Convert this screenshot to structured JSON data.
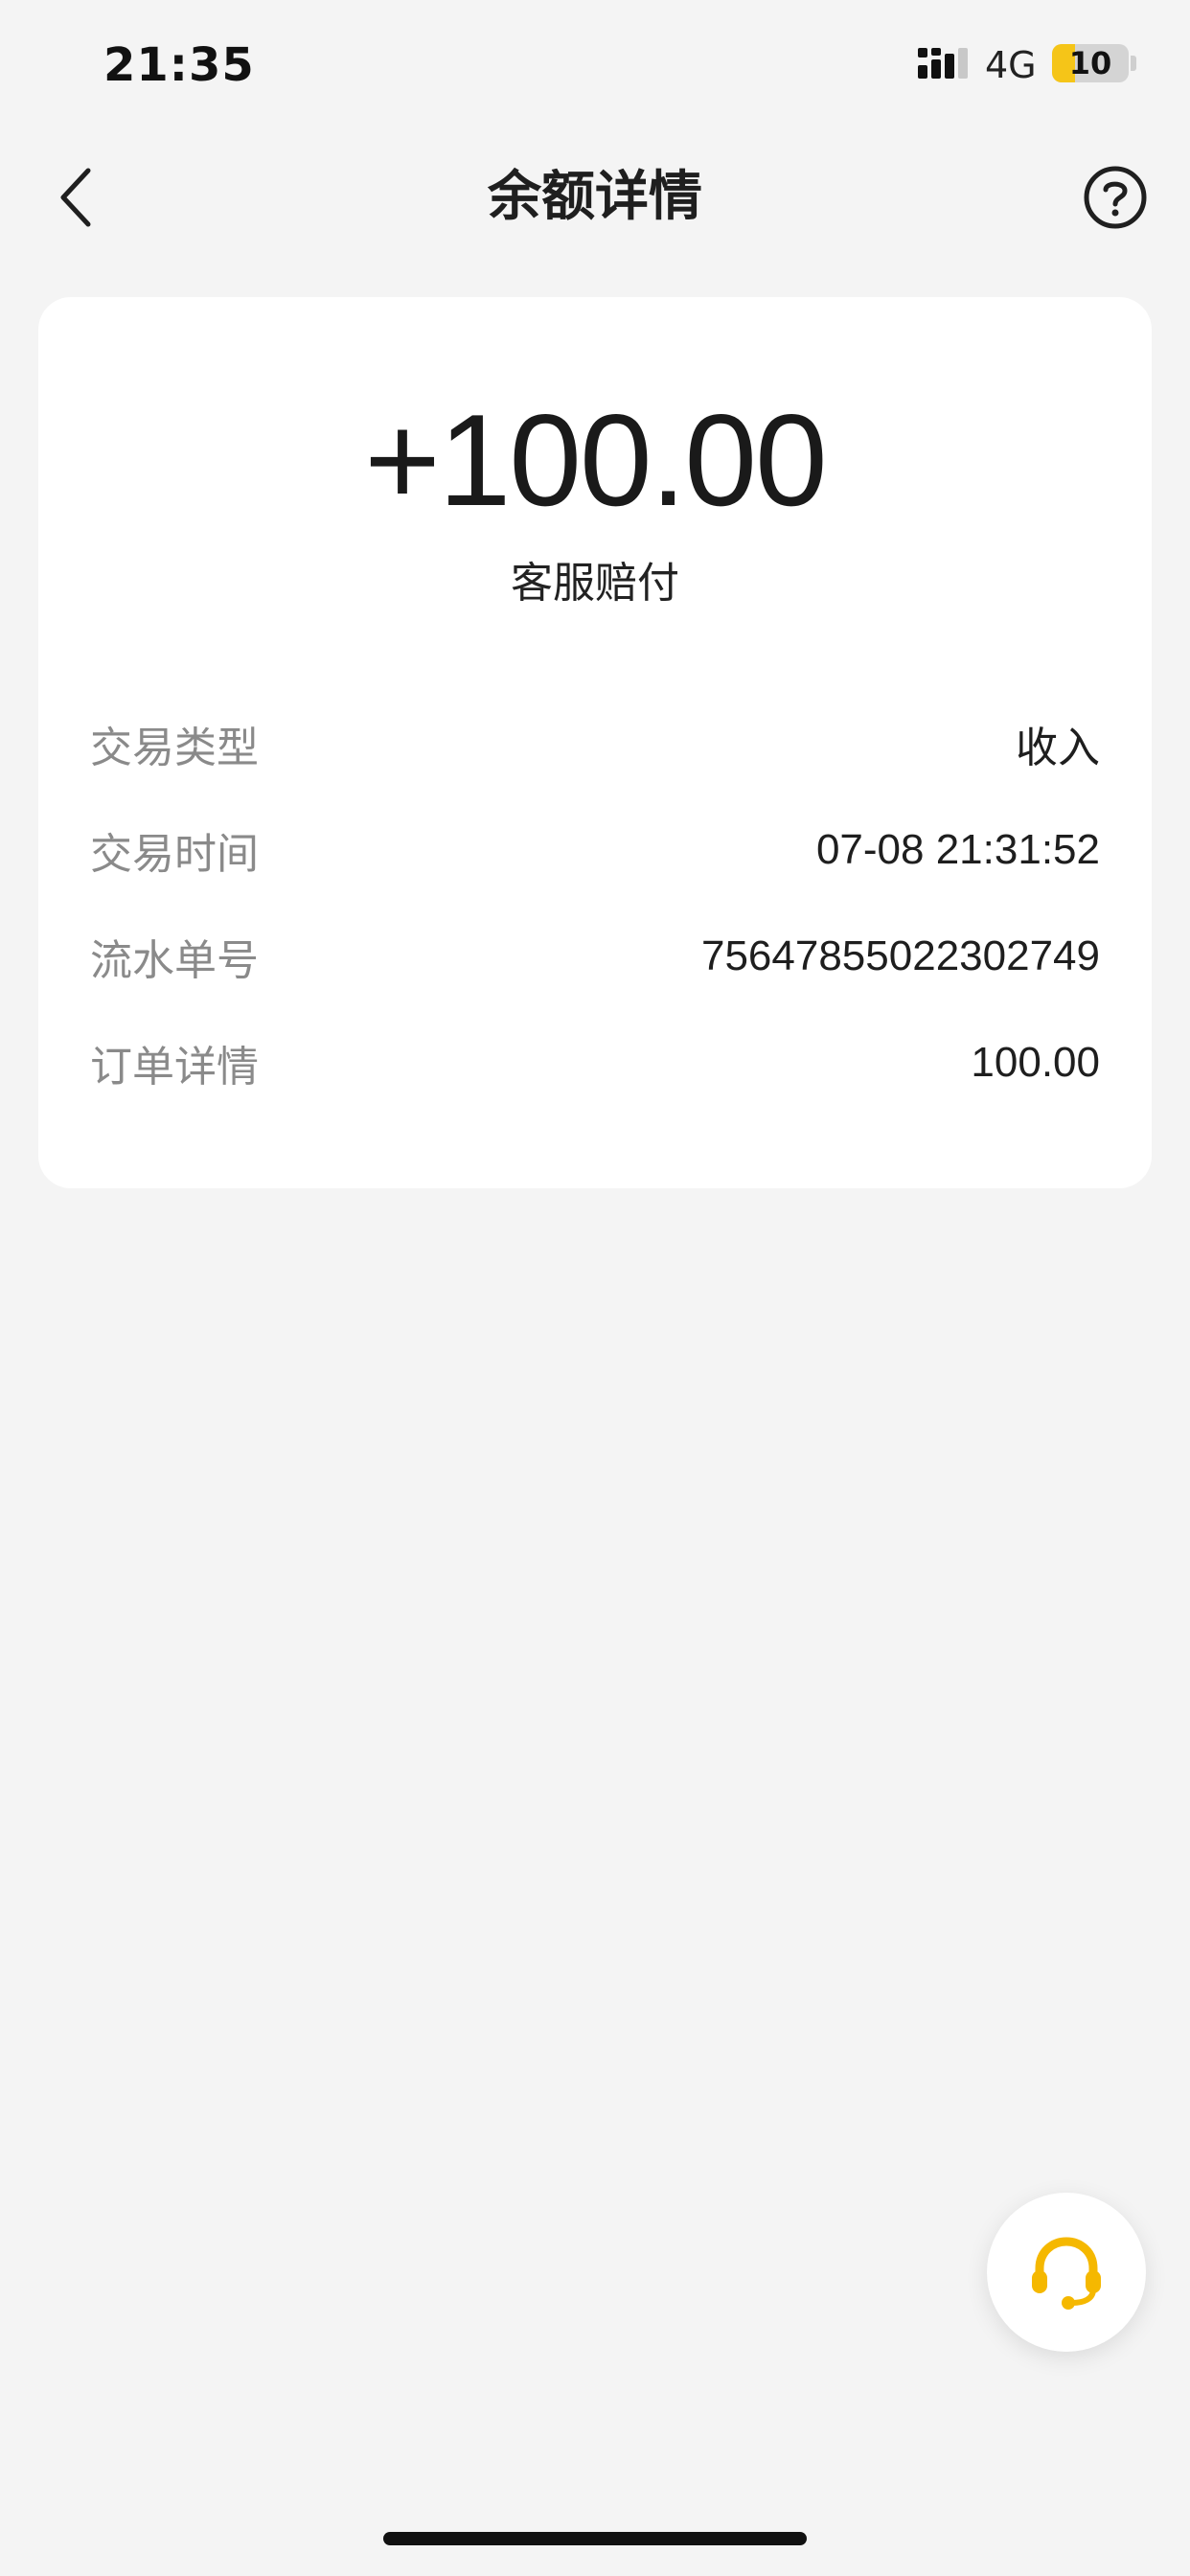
{
  "status_bar": {
    "time": "21:35",
    "network": "4G",
    "battery_level": "10",
    "battery_fraction": 0.3,
    "icons": [
      "signal-icon",
      "battery-icon"
    ]
  },
  "nav": {
    "title": "余额详情",
    "icons": [
      "back-chevron-icon",
      "help-circle-icon"
    ]
  },
  "transaction": {
    "amount": "+100.00",
    "description": "客服赔付",
    "rows": [
      {
        "label": "交易类型",
        "value": "收入"
      },
      {
        "label": "交易时间",
        "value": "07-08 21:31:52"
      },
      {
        "label": "流水单号",
        "value": "7564785502230274​9"
      },
      {
        "label": "订单详情",
        "value": "100.00"
      }
    ]
  },
  "floating": {
    "icon": "headset-icon",
    "accent": "#f5b800"
  },
  "colors": {
    "background": "#f4f4f4",
    "card": "#ffffff",
    "label_gray": "#8a8a8a",
    "accent_yellow": "#f5b800"
  }
}
